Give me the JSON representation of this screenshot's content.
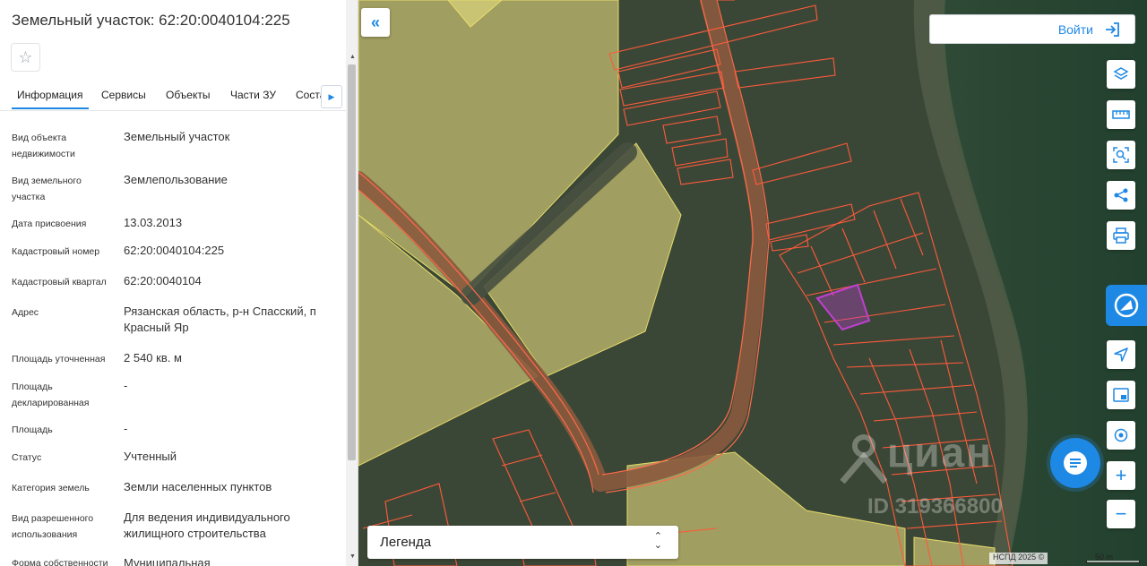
{
  "panel": {
    "title": "Земельный участок: 62:20:0040104:225",
    "favorite_icon": "star-outline-icon",
    "tabs": [
      {
        "label": "Информация",
        "active": true
      },
      {
        "label": "Сервисы",
        "active": false
      },
      {
        "label": "Объекты",
        "active": false
      },
      {
        "label": "Части ЗУ",
        "active": false
      },
      {
        "label": "Соста",
        "active": false
      }
    ],
    "rows": [
      {
        "label": "Вид объекта недвижимости",
        "value": "Земельный участок"
      },
      {
        "label": "Вид земельного участка",
        "value": "Землепользование"
      },
      {
        "label": "Дата присвоения",
        "value": "13.03.2013"
      },
      {
        "label": "Кадастровый номер",
        "value": "62:20:0040104:225"
      },
      {
        "label": "Кадастровый квартал",
        "value": "62:20:0040104"
      },
      {
        "label": "Адрес",
        "value": "Рязанская область, р-н Спасский, п Красный Яр"
      },
      {
        "label": "Площадь уточненная",
        "value": "2 540 кв. м"
      },
      {
        "label": "Площадь декларированная",
        "value": "-"
      },
      {
        "label": "Площадь",
        "value": "-"
      },
      {
        "label": "Статус",
        "value": "Учтенный"
      },
      {
        "label": "Категория земель",
        "value": "Земли населенных пунктов"
      },
      {
        "label": "Вид разрешенного использования",
        "value": "Для ведения индивидуального жилищного строительства"
      },
      {
        "label": "Форма собственности",
        "value": "Муниципальная"
      }
    ]
  },
  "map": {
    "login_label": "Войти",
    "legend_label": "Легенда",
    "attribution": "НСПД 2025 ©",
    "scale_label": "50 m",
    "watermark_brand": "циан",
    "watermark_id": "ID 319366800",
    "toolbar_icons": [
      "layers-icon",
      "ruler-icon",
      "select-area-icon",
      "share-icon",
      "print-icon",
      "nspd-logo-icon",
      "navigation-icon",
      "minimap-icon",
      "geolocation-icon",
      "zoom-in-icon",
      "zoom-out-icon"
    ],
    "accent_color": "#1e88e5",
    "selected_parcel_color": "#c040d0",
    "parcel_border_color": "#ff5a3c",
    "zone_fill_color": "#c8c070"
  }
}
